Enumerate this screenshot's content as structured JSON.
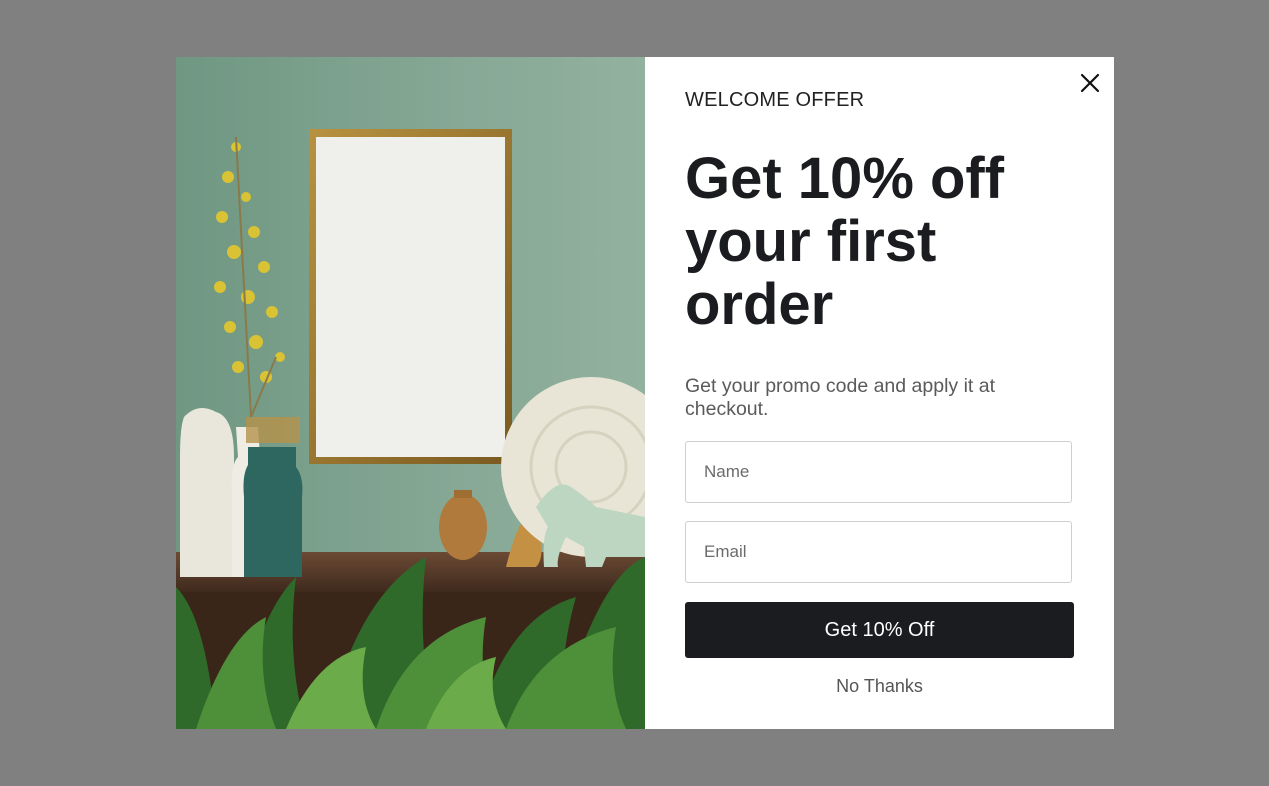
{
  "popup": {
    "eyebrow": "WELCOME OFFER",
    "headline": "Get 10% off your first order",
    "subtext": "Get your promo code and apply it at checkout.",
    "name_placeholder": "Name",
    "email_placeholder": "Email",
    "cta_label": "Get 10% Off",
    "decline_label": "No Thanks",
    "close_icon": "close-icon"
  },
  "colors": {
    "backdrop": "#808080",
    "cta_background": "#1b1c1f",
    "headline": "#1b1c1f",
    "wall": "#86a895"
  }
}
